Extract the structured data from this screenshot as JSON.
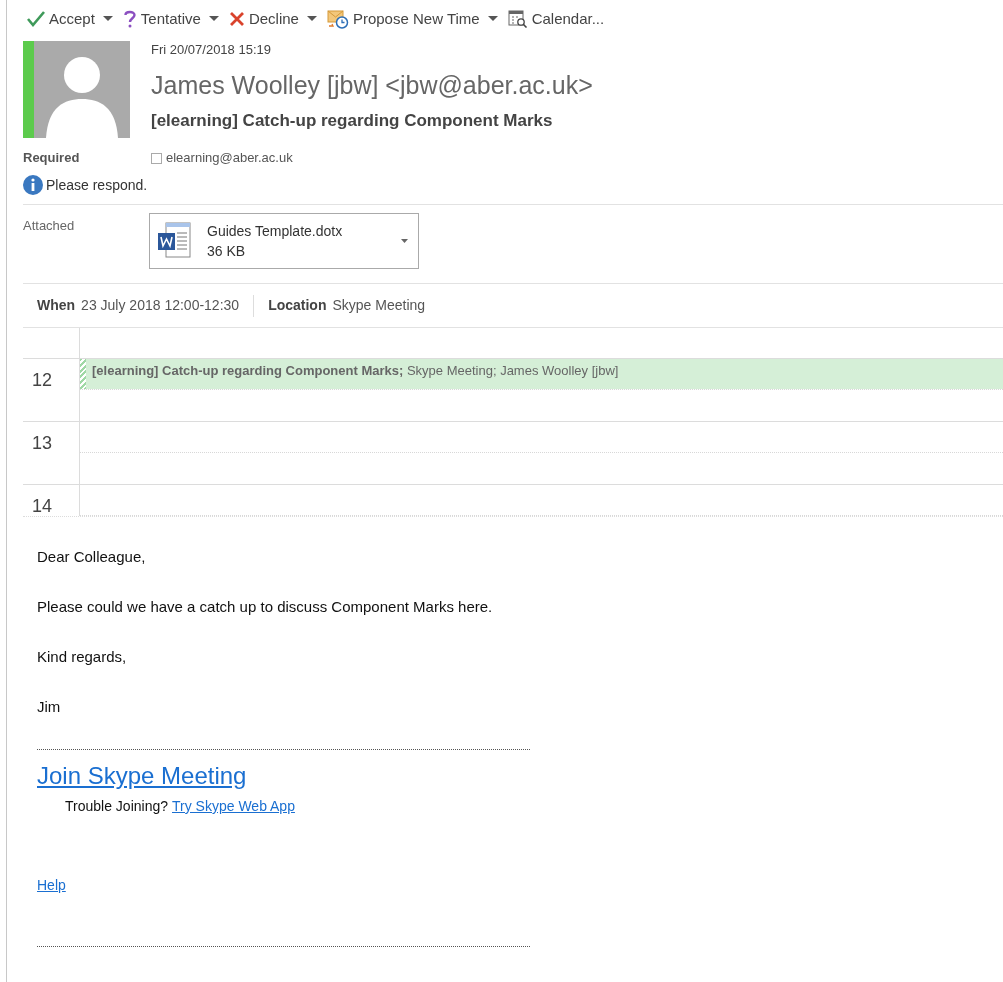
{
  "toolbar": [
    {
      "kind": "accept",
      "label": "Accept",
      "dropdown": true
    },
    {
      "kind": "tentative",
      "label": "Tentative",
      "dropdown": true
    },
    {
      "kind": "decline",
      "label": "Decline",
      "dropdown": true
    },
    {
      "kind": "propose",
      "label": "Propose New Time",
      "dropdown": true
    },
    {
      "kind": "calendar",
      "label": "Calendar...",
      "dropdown": false
    }
  ],
  "header": {
    "sent": "Fri 20/07/2018 15:19",
    "from": "James Woolley [jbw] <jbw@aber.ac.uk>",
    "subject": "[elearning] Catch-up regarding Component Marks",
    "required_label": "Required",
    "required": "elearning@aber.ac.uk",
    "required_checked": false,
    "info": "Please respond."
  },
  "attachments": {
    "label": "Attached",
    "files": [
      {
        "name": "Guides Template.dotx",
        "size": "36 KB"
      }
    ]
  },
  "details": [
    {
      "label": "When",
      "value": "23 July 2018 12:00-12:30"
    },
    {
      "label": "Location",
      "value": "Skype Meeting"
    }
  ],
  "calendar": {
    "hours": [
      {
        "hour": "12",
        "event": "**[elearning] Catch-up regarding Component Marks;** Skype Meeting; James Woolley [jbw]"
      },
      {
        "hour": "13"
      },
      {
        "hour": "14"
      }
    ]
  },
  "body": {
    "paragraphs": [
      "Dear Colleague,",
      "Please could we have a catch up to discuss Component Marks here.",
      "Kind regards,",
      "Jim"
    ],
    "join_link": "Join Skype Meeting",
    "trouble_text": "Trouble Joining?",
    "trouble_link": "Try Skype Web App",
    "help_link": "Help"
  }
}
